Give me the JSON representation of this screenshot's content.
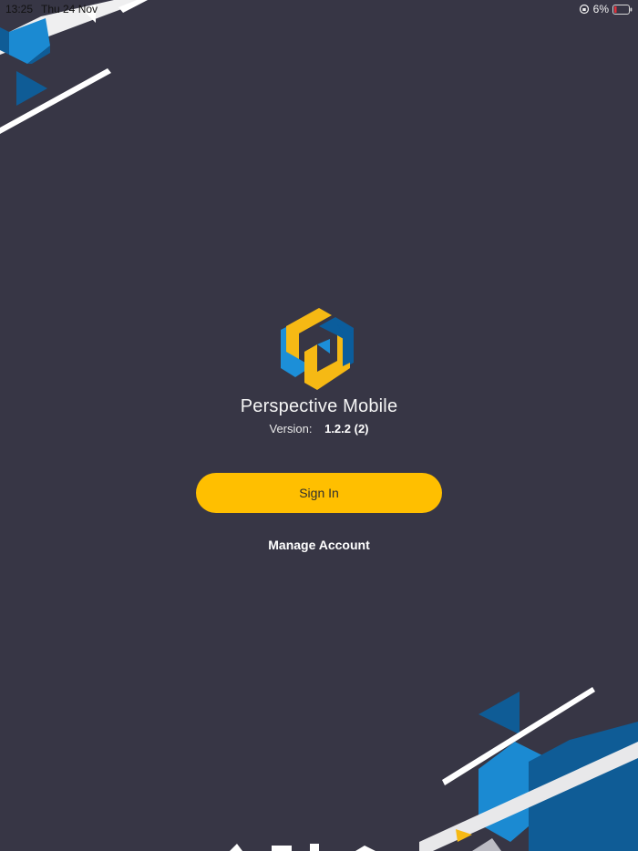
{
  "status_bar": {
    "time": "13:25",
    "date": "Thu 24 Nov",
    "battery": "6%",
    "icons": [
      "orientation-lock-icon",
      "battery-low-icon"
    ]
  },
  "app": {
    "title": "Perspective Mobile",
    "version_label": "Version:",
    "version_value": "1.2.2 (2)"
  },
  "actions": {
    "sign_in_label": "Sign In",
    "manage_account_label": "Manage Account"
  },
  "colors": {
    "background": "#373645",
    "accent_yellow": "#ffbf00",
    "logo_blue": "#0b5d9c",
    "logo_light_blue": "#1c8fd8",
    "logo_yellow": "#f6b914"
  }
}
